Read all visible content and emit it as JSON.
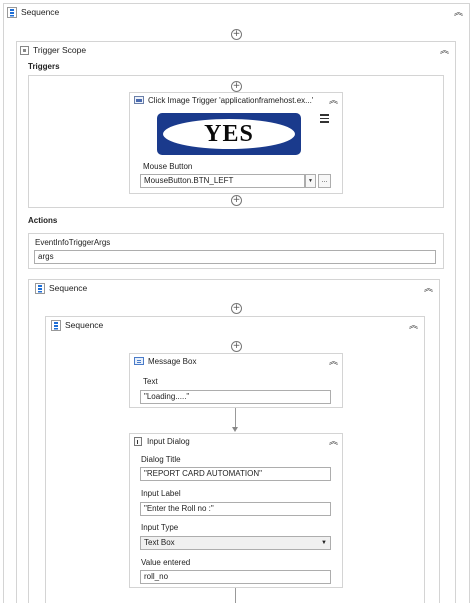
{
  "outer_sequence": {
    "title": "Sequence"
  },
  "trigger_scope": {
    "title": "Trigger Scope",
    "triggers_label": "Triggers",
    "actions_label": "Actions",
    "click_image_trigger": {
      "title": "Click Image Trigger 'applicationframehost.ex...'",
      "image_text": "YES",
      "mouse_button_label": "Mouse Button",
      "mouse_button_value": "MouseButton.BTN_LEFT",
      "browse_label": "..."
    },
    "args_label": "EventInfoTriggerArgs",
    "args_value": "args"
  },
  "inner_sequence": {
    "title": "Sequence"
  },
  "nested_sequence": {
    "title": "Sequence"
  },
  "message_box": {
    "title": "Message Box",
    "text_label": "Text",
    "text_value": "\"Loading.....\""
  },
  "input_dialog": {
    "title": "Input Dialog",
    "dialog_title_label": "Dialog Title",
    "dialog_title_value": "\"REPORT CARD AUTOMATION\"",
    "input_label_label": "Input Label",
    "input_label_value": "\"Enter the Roll no :\"",
    "input_type_label": "Input Type",
    "input_type_value": "Text Box",
    "value_entered_label": "Value entered",
    "value_entered_value": "roll_no"
  },
  "icons": {
    "sequence": "sequence-icon",
    "trigger_scope": "trigger-scope-icon",
    "click_image": "click-image-icon",
    "message_box": "message-box-icon",
    "input_dialog": "input-dialog-icon",
    "collapse": "chevron-up-double-icon",
    "add": "plus-circle-icon",
    "menu": "hamburger-menu-icon",
    "dropdown": "chevron-down-icon"
  },
  "colors": {
    "sequence_icon": "#1e6ed6",
    "border": "#d4d4d4",
    "image_border": "#1a3a8c"
  }
}
